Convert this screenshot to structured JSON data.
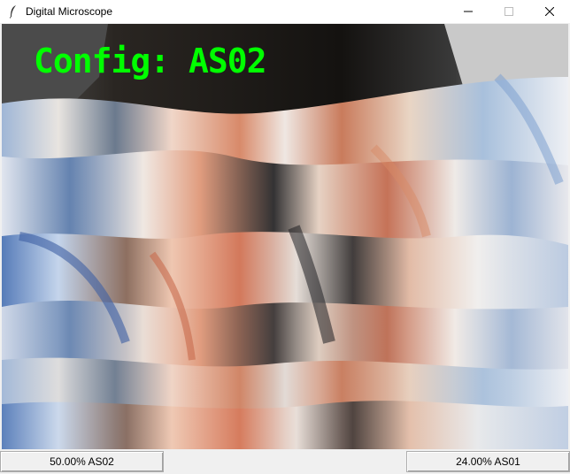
{
  "window": {
    "title": "Digital Microscope",
    "icons": {
      "app": "feather-icon",
      "minimize": "minimize-icon",
      "maximize": "maximize-icon",
      "close": "close-icon"
    }
  },
  "video": {
    "overlay_text": "Config: AS02",
    "overlay_color": "#00ff00"
  },
  "buttons": {
    "left_label": "50.00% AS02",
    "right_label": "24.00% AS01"
  }
}
